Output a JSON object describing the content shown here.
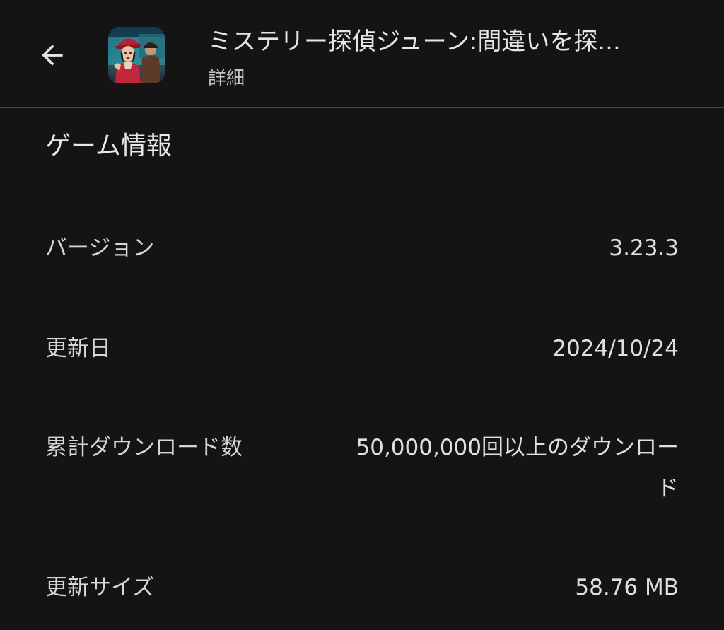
{
  "header": {
    "back_icon": "arrow-back-icon",
    "app_icon": "app-icon",
    "title": "ミステリー探偵ジューン:間違いを探...",
    "subtitle": "詳細"
  },
  "section": {
    "heading": "ゲーム情報"
  },
  "details": {
    "version": {
      "label": "バージョン",
      "value": "3.23.3"
    },
    "updated_on": {
      "label": "更新日",
      "value": "2024/10/24"
    },
    "downloads": {
      "label": "累計ダウンロード数",
      "value": "50,000,000回以上のダウンロード"
    },
    "update_size": {
      "label": "更新サイズ",
      "value": "58.76 MB"
    }
  },
  "colors": {
    "background": "#141414",
    "divider": "#4a4a4a",
    "text_primary": "#e3e3e3",
    "text_secondary": "#c4c4c4"
  }
}
